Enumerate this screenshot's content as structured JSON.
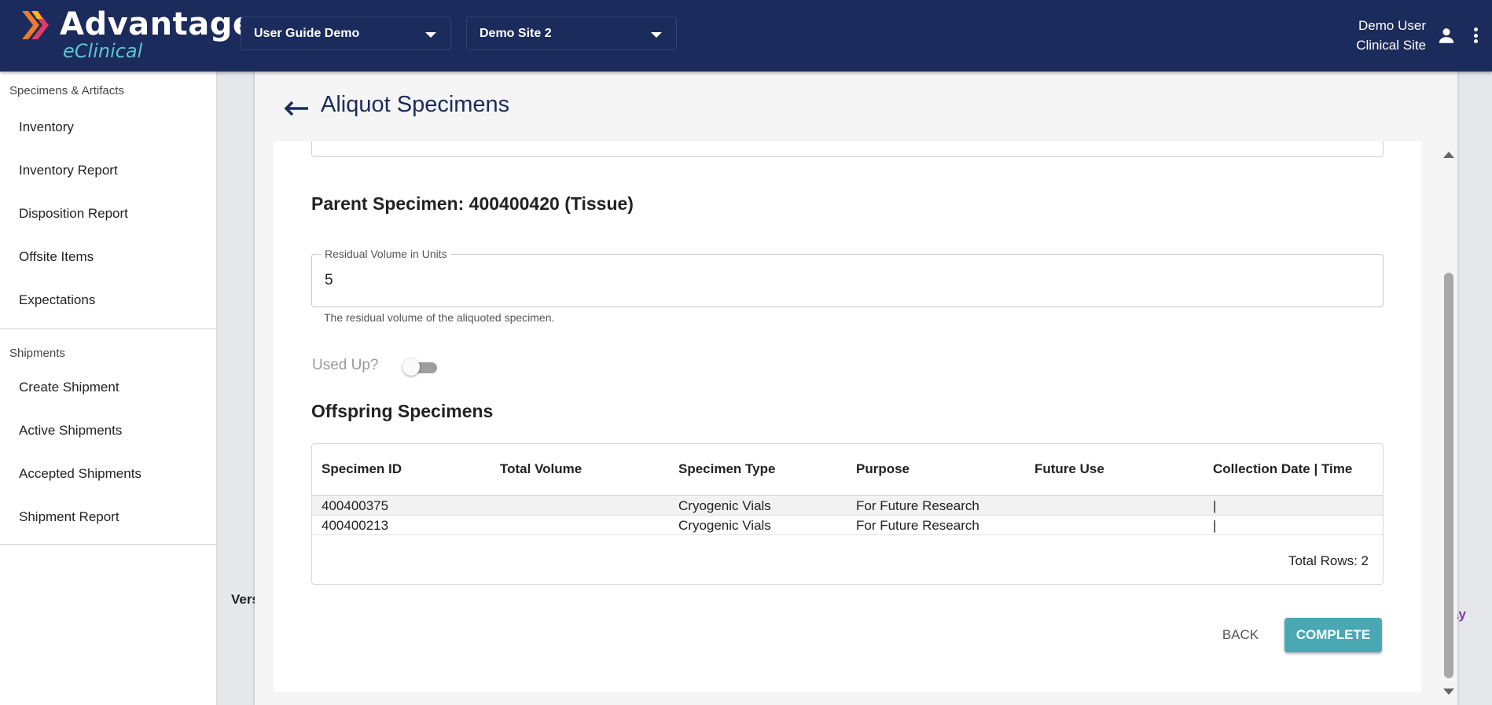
{
  "header": {
    "logo_title": "Advantage",
    "logo_subtitle": "eClinical",
    "study_dropdown": "User Guide Demo",
    "site_dropdown": "Demo Site 2",
    "user_name": "Demo User",
    "user_role": "Clinical Site",
    "icons": {
      "user": "person-icon",
      "menu": "more-vert-icon"
    }
  },
  "sidebar": {
    "section1": "Specimens & Artifacts",
    "items1": [
      "Inventory",
      "Inventory Report",
      "Disposition Report",
      "Offsite Items",
      "Expectations"
    ],
    "section2": "Shipments",
    "items2": [
      "Create Shipment",
      "Active Shipments",
      "Accepted Shipments",
      "Shipment Report"
    ]
  },
  "background": {
    "version_fragment": "Vers",
    "link_fragment": "ay"
  },
  "page": {
    "title": "Aliquot Specimens",
    "parent_specimen": "Parent Specimen: 400400420 (Tissue)",
    "residual_label": "Residual Volume in Units",
    "residual_value": "5",
    "residual_help": "The residual volume of the aliquoted specimen.",
    "used_up_label": "Used Up?",
    "used_up_checked": false,
    "offspring_title": "Offspring Specimens",
    "table": {
      "columns": [
        "Specimen ID",
        "Total Volume",
        "Specimen Type",
        "Purpose",
        "Future Use",
        "Collection Date | Time"
      ],
      "rows": [
        [
          "400400375",
          "",
          "Cryogenic Vials",
          "For Future Research",
          "",
          "|"
        ],
        [
          "400400213",
          "",
          "Cryogenic Vials",
          "For Future Research",
          "",
          "|"
        ]
      ],
      "total_rows": "Total Rows: 2"
    },
    "back_button": "BACK",
    "complete_button": "COMPLETE"
  },
  "colors": {
    "header_bg": "#1b2b5b",
    "accent": "#4aa8b5",
    "logo_teal": "#5cc4d4"
  }
}
